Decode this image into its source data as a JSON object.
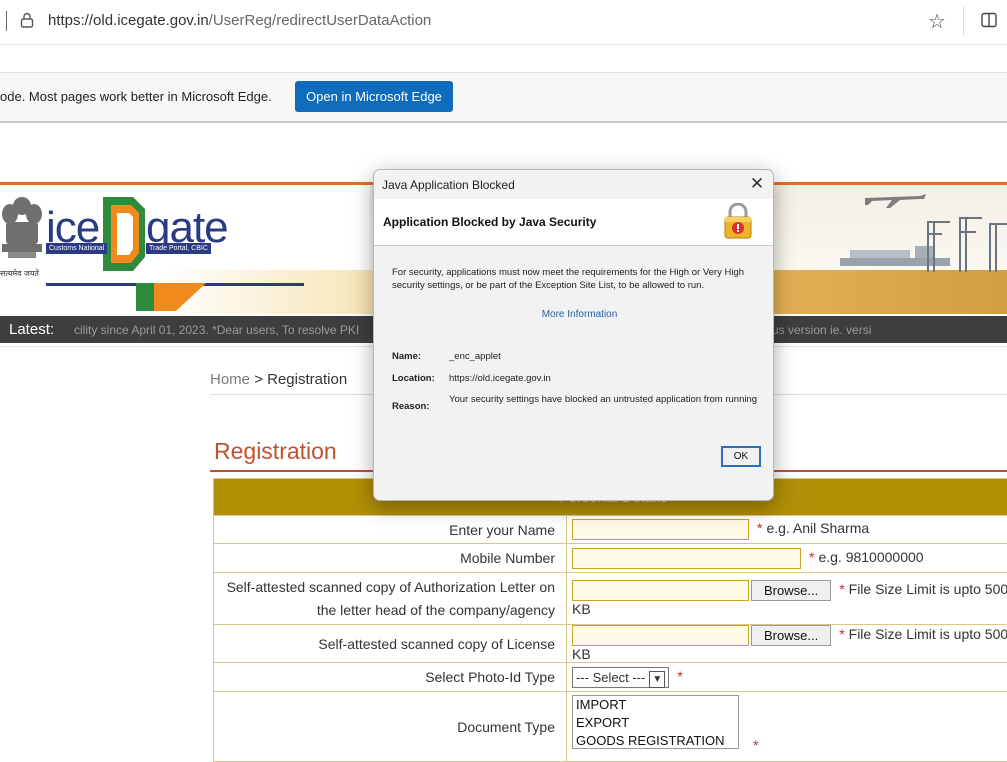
{
  "browser": {
    "url_host": "https://old.icegate.gov.in",
    "url_path": "/UserReg/redirectUserDataAction",
    "infobar_message": "ode. Most pages work better in Microsoft Edge.",
    "infobar_button": "Open in Microsoft Edge"
  },
  "header": {
    "logo_left": "ice",
    "logo_right": "gate",
    "tag_left": "Customs National",
    "tag_right": "Trade Portal, CBIC",
    "emblem_caption": "सत्यमेव जयते",
    "latest_label": "Latest:",
    "ticker_left": "cility since April 01, 2023. *Dear users, To resolve PKI",
    "ticker_right": "us version ie. versi"
  },
  "breadcrumb": {
    "home": "Home",
    "separator": ">",
    "current": "Registration"
  },
  "page_title": "Registration",
  "form": {
    "section_header": "Personal Details",
    "rows": [
      {
        "label": "Enter your Name",
        "hint": "e.g. Anil Sharma"
      },
      {
        "label": "Mobile Number",
        "hint": "e.g. 9810000000"
      },
      {
        "label_line1": "Self-attested scanned copy of Authorization Letter on",
        "label_line2": "the letter head of the company/agency",
        "button": "Browse...",
        "hint": "File Size Limit is upto 500 KB"
      },
      {
        "label": "Self-attested scanned copy of License",
        "button": "Browse...",
        "hint": "File Size Limit is upto 500 KB"
      },
      {
        "label": "Select Photo-Id Type",
        "select_value": "--- Select ---"
      },
      {
        "label": "Document Type",
        "options": [
          "IMPORT",
          "EXPORT",
          "GOODS REGISTRATION"
        ]
      }
    ],
    "required_mark": "*"
  },
  "dialog": {
    "title": "Java Application Blocked",
    "heading": "Application Blocked by Java Security",
    "message": "For security, applications must now meet the requirements for the High or Very High security settings, or be part of the Exception Site List, to be allowed to run.",
    "more_info": "More Information",
    "name_label": "Name:",
    "name_value": "_enc_applet",
    "location_label": "Location:",
    "location_value": "https://old.icegate.gov.in",
    "reason_label": "Reason:",
    "reason_value": "Your security settings have blocked an untrusted application from running",
    "ok_label": "OK"
  },
  "colors": {
    "accent_orange": "#e5701f",
    "logo_blue": "#2a3b84",
    "title_red": "#c0502f",
    "table_header_gold": "#b18f06",
    "edge_button_blue": "#0f6cbd"
  },
  "icons": [
    "lock-icon",
    "favorite-star-icon",
    "split-screen-icon",
    "close-icon",
    "padlock-warning-icon",
    "dropdown-arrow-icon"
  ]
}
